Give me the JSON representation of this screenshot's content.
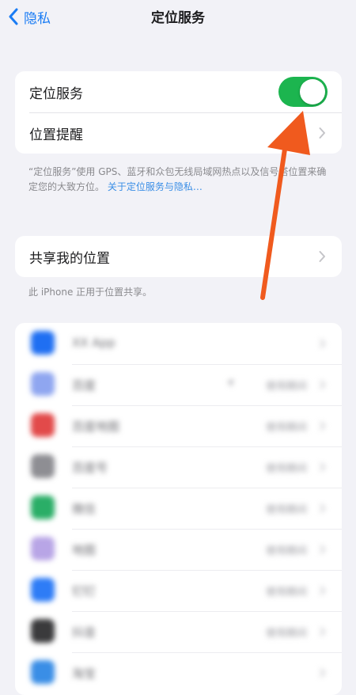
{
  "nav": {
    "back_label": "隐私",
    "title": "定位服务"
  },
  "main_card": {
    "location_services_label": "定位服务",
    "location_services_on": true,
    "location_alerts_label": "位置提醒"
  },
  "footer_note": {
    "text": "“定位服务”使用 GPS、蓝牙和众包无线局域网热点以及信号塔位置来确定您的大致方位。",
    "link": "关于定位服务与隐私…"
  },
  "share_card": {
    "share_label": "共享我的位置"
  },
  "share_note": "此 iPhone 正用于位置共享。",
  "apps": [
    {
      "name": "XX App",
      "status": "",
      "icon_color": "#1f6ff2"
    },
    {
      "name": "百度",
      "status": "使用期间",
      "icon_color": "#8fa6f0",
      "location_arrow": true
    },
    {
      "name": "百度地图",
      "status": "使用期间",
      "icon_color": "#e24a4a"
    },
    {
      "name": "百度号",
      "status": "使用期间",
      "icon_color": "#8e8e93"
    },
    {
      "name": "微信",
      "status": "使用期间",
      "icon_color": "#2aae67"
    },
    {
      "name": "地图",
      "status": "使用期间",
      "icon_color": "#b8a5e6"
    },
    {
      "name": "钉钉",
      "status": "使用期间",
      "icon_color": "#2e7cf6"
    },
    {
      "name": "抖音",
      "status": "使用期间",
      "icon_color": "#3a3a3c"
    },
    {
      "name": "淘宝",
      "status": "",
      "icon_color": "#3a8ee6"
    }
  ],
  "colors": {
    "accent": "#1a7cf4",
    "toggle_on": "#1cb54f",
    "annotation_arrow": "#f05a1e"
  }
}
